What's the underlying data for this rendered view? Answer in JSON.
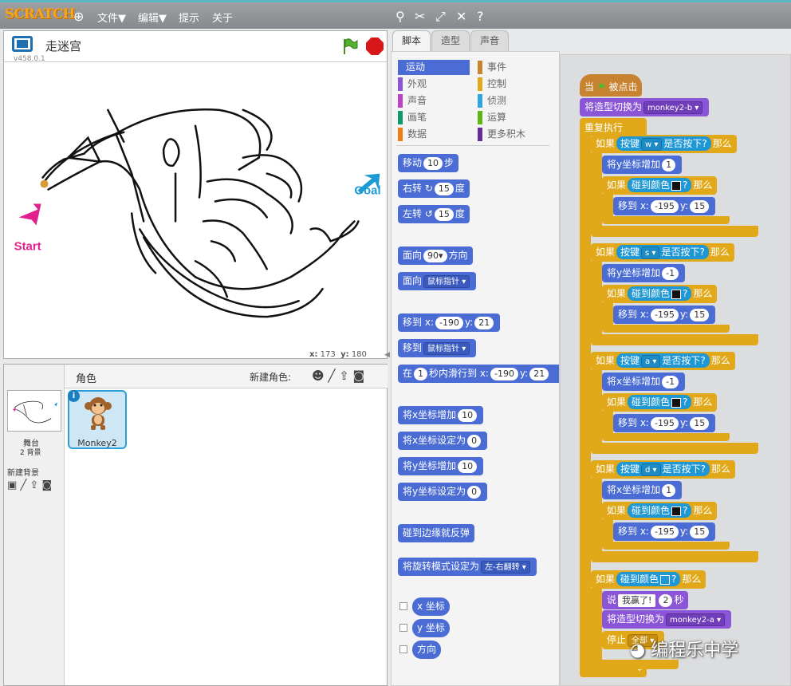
{
  "menubar": {
    "logo": "SCRATCH",
    "file": "文件▼",
    "edit": "编辑▼",
    "tips": "提示",
    "about": "关于"
  },
  "stage": {
    "title": "走迷宫",
    "version": "v458.0.1",
    "start_label": "Start",
    "goal_label": "Goal",
    "x_label": "x:",
    "x_value": "173",
    "y_label": "y:",
    "y_value": "180"
  },
  "sprites": {
    "header": "角色",
    "new_sprite": "新建角色:",
    "stage_label": "舞台",
    "stage_bg_count": "2 背景",
    "new_backdrop": "新建背景",
    "sprite_name": "Monkey2"
  },
  "tabs": [
    "脚本",
    "造型",
    "声音"
  ],
  "categories": {
    "left": [
      "运动",
      "外观",
      "声音",
      "画笔",
      "数据"
    ],
    "right": [
      "事件",
      "控制",
      "侦测",
      "运算",
      "更多积木"
    ],
    "colors": {
      "运动": "#4a6cd4",
      "外观": "#8a55d7",
      "声音": "#bb42c3",
      "画笔": "#0e9a6c",
      "数据": "#ee7d16",
      "事件": "#c88330",
      "控制": "#e1a91a",
      "侦测": "#2ca5e2",
      "运算": "#5cb712",
      "更多积木": "#632d99"
    }
  },
  "palette": {
    "move": "移动",
    "move_n": "10",
    "steps": "步",
    "turn_right": "右转",
    "turn_left": "左转",
    "turn_deg": "15",
    "deg": "度",
    "point_dir": "面向",
    "dir_val": "90▾",
    "dir_suffix": "方向",
    "point_towards": "面向",
    "mouse_ptr": "鼠标指针 ▾",
    "goto_xy": "移到 x:",
    "goto_x": "-190",
    "y": "y:",
    "goto_y": "21",
    "goto": "移到",
    "goto_target": "鼠标指针 ▾",
    "glide_pre": "在",
    "glide_secs": "1",
    "glide_mid": "秒内滑行到 x:",
    "glide_x": "-190",
    "glide_y": "21",
    "change_x": "将x坐标增加",
    "change_x_n": "10",
    "set_x": "将x坐标设定为",
    "set_x_n": "0",
    "change_y": "将y坐标增加",
    "change_y_n": "10",
    "set_y": "将y坐标设定为",
    "set_y_n": "0",
    "bounce": "碰到边缘就反弹",
    "rot_style": "将旋转模式设定为",
    "rot_val": "左-右翻转 ▾",
    "xpos": "x 坐标",
    "ypos": "y 坐标",
    "direction": "方向"
  },
  "script": {
    "when": "当",
    "clicked": "被点击",
    "switch_costume": "将造型切换为",
    "costume_b": "monkey2-b ▾",
    "forever": "重复执行",
    "if": "如果",
    "then": "那么",
    "key": "按键",
    "pressed": "是否按下?",
    "keys": [
      "w ▾",
      "s ▾",
      "a ▾",
      "d ▾"
    ],
    "change_y": "将y坐标增加",
    "change_x": "将x坐标增加",
    "deltas": [
      "1",
      "-1",
      "-1",
      "1"
    ],
    "touching": "碰到颜色",
    "q": "?",
    "goto": "移到 x:",
    "gx": "-195",
    "gy_label": "y:",
    "gy": "15",
    "say": "说",
    "say_text": "我赢了!",
    "say_secs": "2",
    "secs": "秒",
    "costume_a": "monkey2-a ▾",
    "stop": "停止",
    "stop_val": "全部 ▾"
  },
  "watermark": "编程乐中学"
}
